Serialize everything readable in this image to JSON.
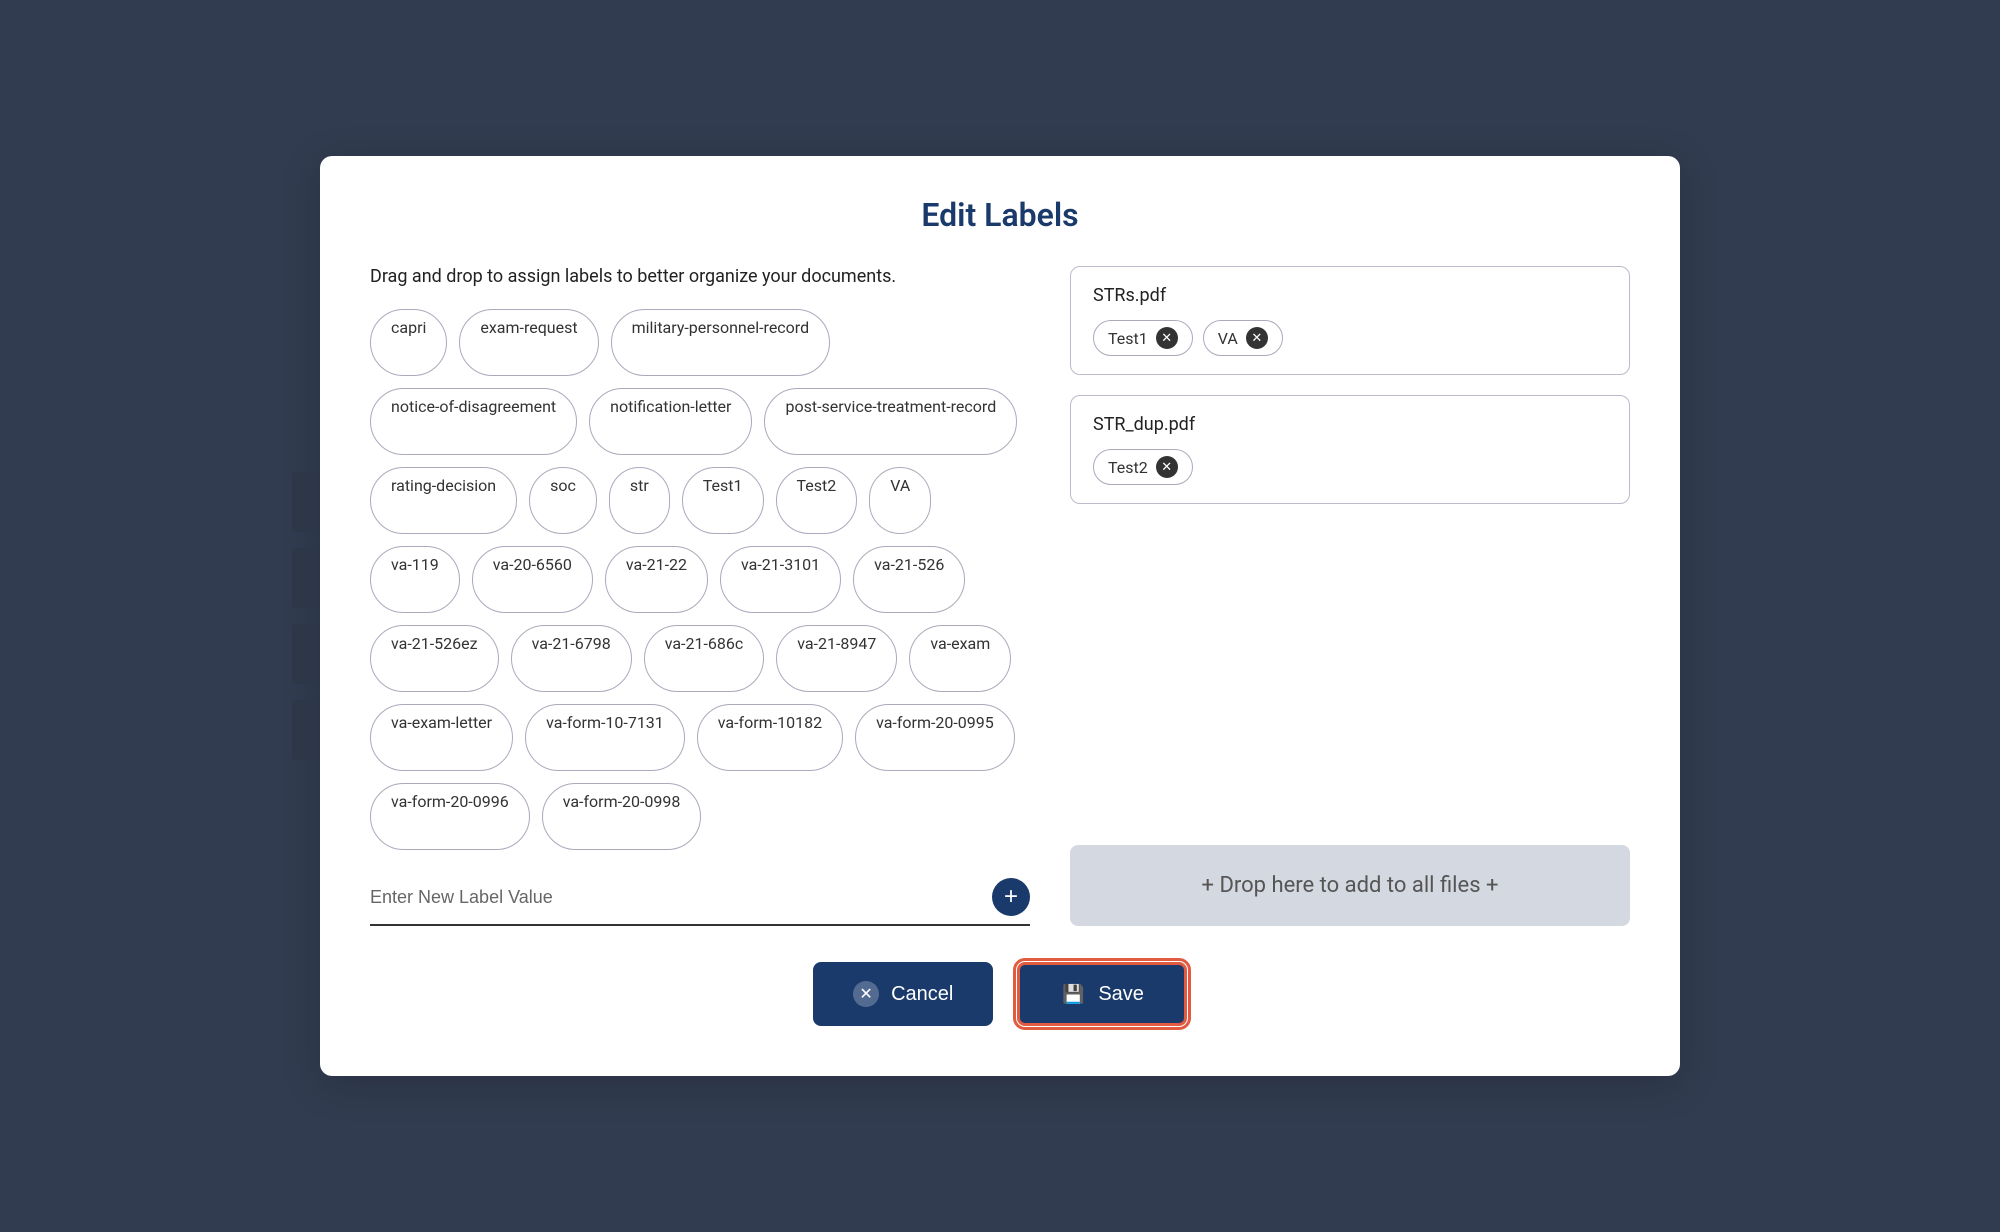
{
  "modal": {
    "title": "Edit Labels"
  },
  "instruction": "Drag and drop to assign labels to better organize your documents.",
  "labels": [
    "capri",
    "exam-request",
    "military-personnel-record",
    "notice-of-disagreement",
    "notification-letter",
    "post-service-treatment-record",
    "rating-decision",
    "soc",
    "str",
    "Test1",
    "Test2",
    "VA",
    "va-119",
    "va-20-6560",
    "va-21-22",
    "va-21-3101",
    "va-21-526",
    "va-21-526ez",
    "va-21-6798",
    "va-21-686c",
    "va-21-8947",
    "va-exam",
    "va-exam-letter",
    "va-form-10-7131",
    "va-form-10182",
    "va-form-20-0995",
    "va-form-20-0996",
    "va-form-20-0998"
  ],
  "new_label_placeholder": "Enter New Label Value",
  "files": [
    {
      "name": "STRs.pdf",
      "labels": [
        "Test1",
        "VA"
      ]
    },
    {
      "name": "STR_dup.pdf",
      "labels": [
        "Test2"
      ]
    }
  ],
  "drop_all_text": "+ Drop here to add to all files +",
  "buttons": {
    "cancel": "Cancel",
    "save": "Save"
  }
}
